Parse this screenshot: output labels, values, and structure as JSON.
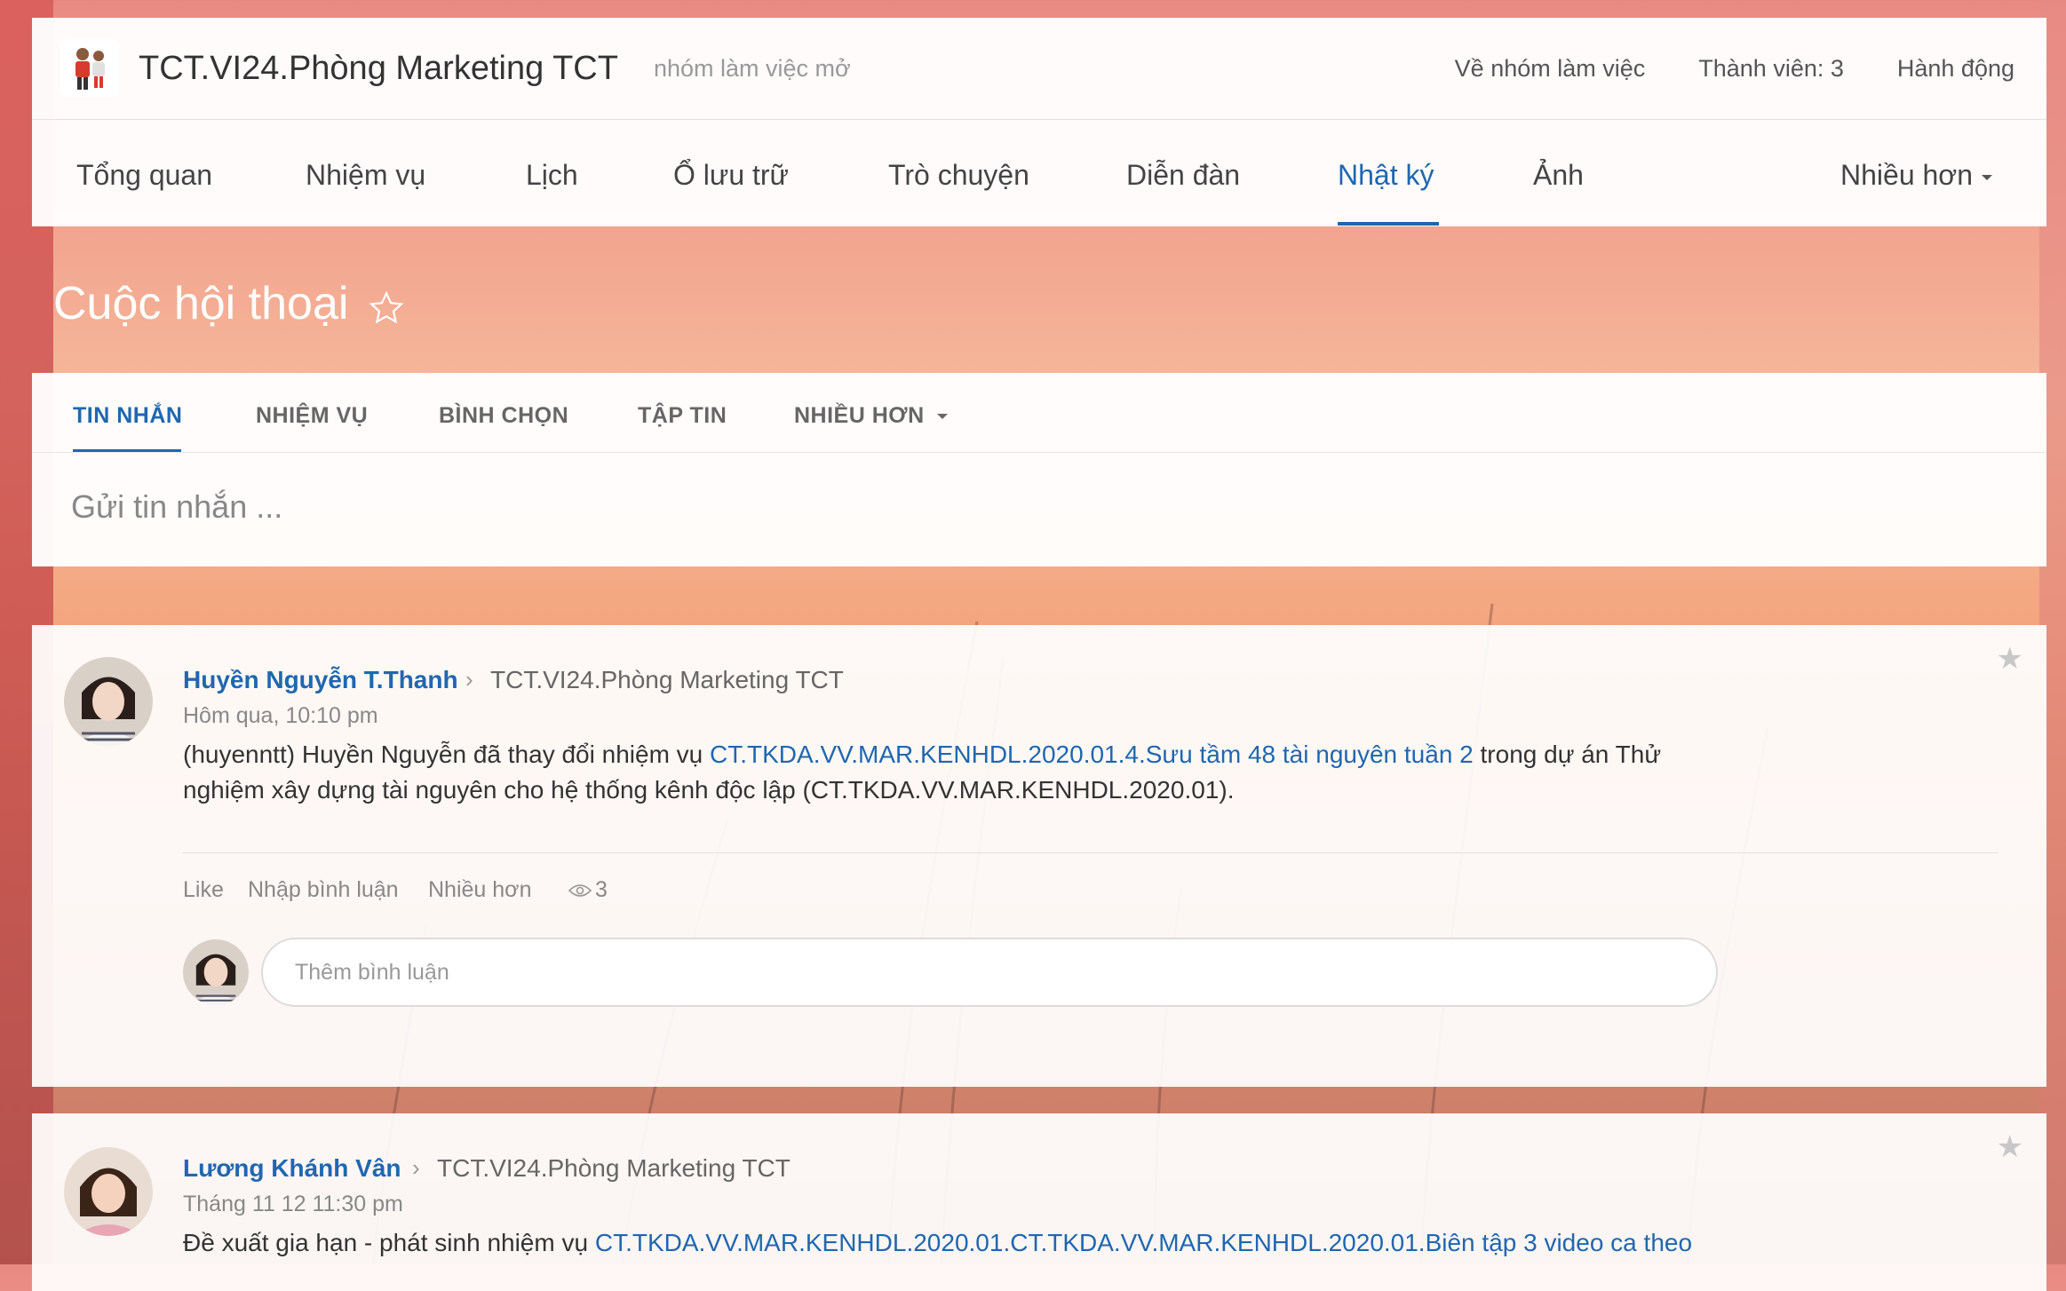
{
  "header": {
    "group_title": "TCT.VI24.Phòng Marketing TCT",
    "group_type": "nhóm làm việc mở",
    "about": "Về nhóm làm việc",
    "members": "Thành viên: 3",
    "actions": "Hành động"
  },
  "nav": {
    "items": [
      "Tổng quan",
      "Nhiệm vụ",
      "Lịch",
      "Ổ lưu trữ",
      "Trò chuyện",
      "Diễn đàn",
      "Nhật ký",
      "Ảnh"
    ],
    "more": "Nhiều hơn",
    "active": "Nhật ký"
  },
  "page": {
    "title": "Cuộc hội thoại"
  },
  "composer": {
    "tabs": [
      "TIN NHẮN",
      "NHIỆM VỤ",
      "BÌNH CHỌN",
      "TẬP TIN",
      "NHIỀU HƠN"
    ],
    "active_tab": "TIN NHẮN",
    "placeholder": "Gửi tin nhắn ..."
  },
  "posts": [
    {
      "author": "Huyền Nguyễn T.Thanh",
      "group": "TCT.VI24.Phòng Marketing TCT",
      "time": "Hôm qua, 10:10 pm",
      "text_before": "(huyenntt) Huyền Nguyễn đã thay đổi nhiệm vụ ",
      "link": "CT.TKDA.VV.MAR.KENHDL.2020.01.4.Sưu tầm 48 tài nguyên tuần 2",
      "text_after": " trong dự án Thử nghiệm xây dựng tài nguyên cho hệ thống kênh độc lập (CT.TKDA.VV.MAR.KENHDL.2020.01).",
      "actions": {
        "like": "Like",
        "comment": "Nhập bình luận",
        "more": "Nhiều hơn"
      },
      "views": "3",
      "comment_placeholder": "Thêm bình luận"
    },
    {
      "author": "Lương Khánh Vân",
      "group": "TCT.VI24.Phòng Marketing TCT",
      "time": "Tháng 11 12 11:30 pm",
      "text_before": "Đề xuất gia hạn - phát sinh nhiệm vụ ",
      "link": "CT.TKDA.VV.MAR.KENHDL.2020.01.CT.TKDA.VV.MAR.KENHDL.2020.01.Biên tập 3 video ca theo"
    }
  ],
  "colors": {
    "accent": "#2067b0",
    "text": "#333333",
    "muted": "#888888"
  }
}
